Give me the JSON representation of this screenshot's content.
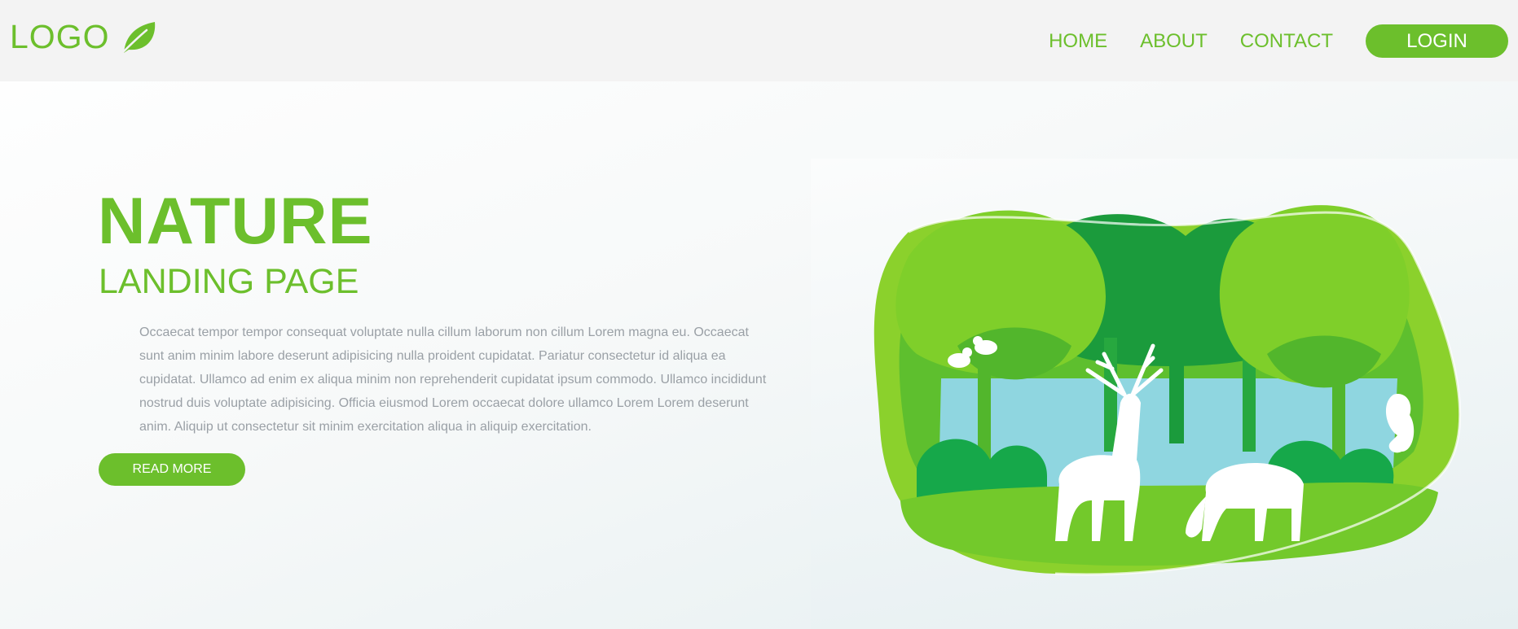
{
  "header": {
    "logo_text": "LOGO",
    "logo_icon": "leaf-icon",
    "nav": [
      "HOME",
      "ABOUT",
      "CONTACT"
    ],
    "login_label": "LOGIN"
  },
  "hero": {
    "title": "NATURE",
    "subtitle": "LANDING PAGE",
    "body": "Occaecat tempor tempor consequat voluptate nulla cillum laborum non cillum Lorem magna eu. Occaecat sunt anim minim labore deserunt adipisicing nulla proident cupidatat. Pariatur consectetur id aliqua ea cupidatat. Ullamco ad enim ex aliqua minim non reprehenderit cupidatat ipsum commodo. Ullamco incididunt nostrud duis voluptate adipisicing. Officia eiusmod Lorem occaecat dolore ullamco Lorem Lorem deserunt anim. Aliquip ut consectetur sit minim exercitation aliqua in aliquip exercitation.",
    "read_more_label": "READ MORE"
  },
  "illustration": {
    "subject": "paper-cut forest with deer, birds and squirrel"
  },
  "colors": {
    "accent": "#6cbf2c",
    "header_bg": "#f3f3f3",
    "body_text": "#9aa0a6",
    "sky": "#8fd6e0"
  }
}
